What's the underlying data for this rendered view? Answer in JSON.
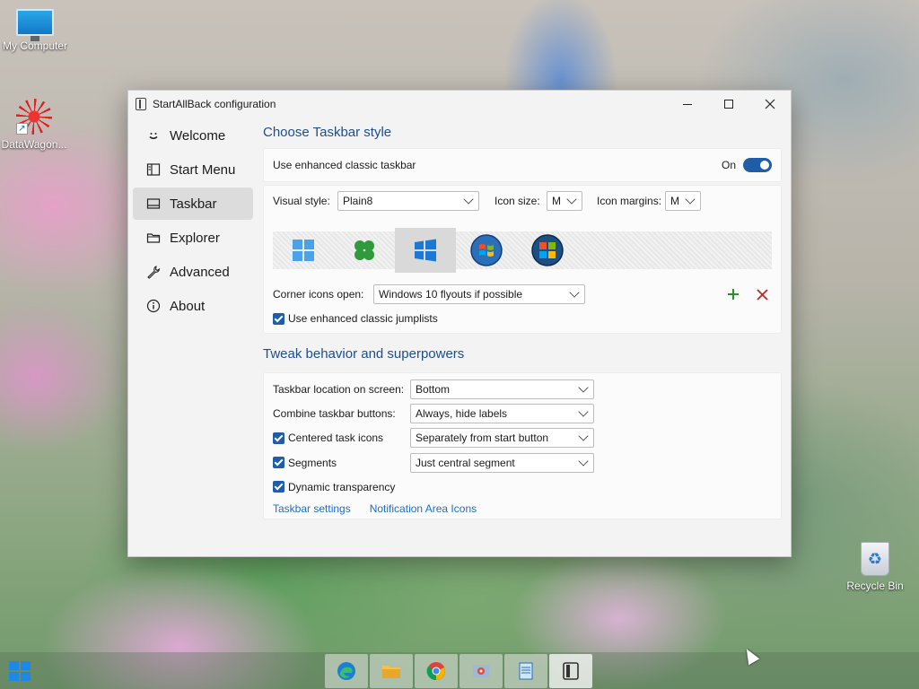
{
  "desktop": {
    "icons": [
      {
        "label": "My Computer",
        "icon": "computer-icon"
      },
      {
        "label": "DataWagon...",
        "icon": "datawagon-icon"
      },
      {
        "label": "Recycle Bin",
        "icon": "recycle-bin-icon"
      }
    ]
  },
  "window": {
    "title": "StartAllBack configuration",
    "controls": {
      "minimize": "minimize-icon",
      "maximize": "maximize-icon",
      "close": "close-icon"
    }
  },
  "sidebar": {
    "items": [
      {
        "label": "Welcome",
        "icon": "smile-icon"
      },
      {
        "label": "Start Menu",
        "icon": "start-menu-icon"
      },
      {
        "label": "Taskbar",
        "icon": "taskbar-icon",
        "active": true
      },
      {
        "label": "Explorer",
        "icon": "folder-icon"
      },
      {
        "label": "Advanced",
        "icon": "wrench-icon"
      },
      {
        "label": "About",
        "icon": "info-icon"
      }
    ]
  },
  "taskbar_style": {
    "section_title": "Choose Taskbar style",
    "enhanced_label": "Use enhanced classic taskbar",
    "enhanced_state": "On",
    "visual_style_label": "Visual style:",
    "visual_style_value": "Plain8",
    "icon_size_label": "Icon size:",
    "icon_size_value": "M",
    "icon_margins_label": "Icon margins:",
    "icon_margins_value": "M",
    "style_options": [
      "windows-11-style-icon",
      "clover-style-icon",
      "windows-10-style-icon",
      "windows-7-orb-icon",
      "windows-vista-orb-icon"
    ],
    "selected_style_index": 2,
    "corner_icons_label": "Corner icons open:",
    "corner_icons_value": "Windows 10 flyouts if possible",
    "jumplists_label": "Use enhanced classic jumplists",
    "jumplists_checked": true
  },
  "tweak": {
    "section_title": "Tweak behavior and superpowers",
    "location_label": "Taskbar location on screen:",
    "location_value": "Bottom",
    "combine_label": "Combine taskbar buttons:",
    "combine_value": "Always, hide labels",
    "centered_label": "Centered task icons",
    "centered_checked": true,
    "centered_value": "Separately from start button",
    "segments_label": "Segments",
    "segments_checked": true,
    "segments_value": "Just central segment",
    "dynamic_label": "Dynamic transparency",
    "dynamic_checked": true,
    "link_taskbar_settings": "Taskbar settings",
    "link_notification_icons": "Notification Area Icons"
  },
  "taskbar": {
    "apps": [
      "edge-icon",
      "file-explorer-icon",
      "chrome-icon",
      "control-panel-icon",
      "notepad-icon",
      "startallback-icon"
    ],
    "active_app_index": 5
  },
  "colors": {
    "accent": "#1f5ea7",
    "section_title": "#1e4e8c",
    "link": "#1a6fc9",
    "add": "#2e8b2e",
    "remove": "#b03030"
  }
}
